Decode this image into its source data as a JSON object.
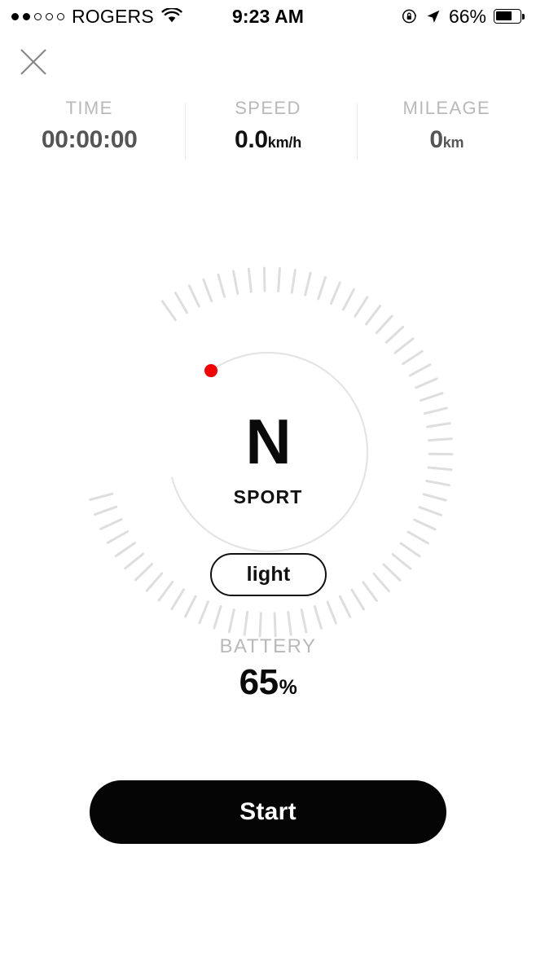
{
  "status_bar": {
    "carrier": "ROGERS",
    "signal_dots_filled": 2,
    "signal_dots_total": 5,
    "wifi_icon": "wifi-icon",
    "time": "9:23 AM",
    "rotation_lock_icon": "rotation-lock-icon",
    "location_icon": "location-arrow-icon",
    "battery_percent": "66%",
    "battery_icon": "battery-icon"
  },
  "nav": {
    "close_icon": "close-icon"
  },
  "stats": [
    {
      "label": "TIME",
      "value": "00:00:00",
      "unit": "",
      "emphasis": false
    },
    {
      "label": "SPEED",
      "value": "0.0",
      "unit": "km/h",
      "emphasis": true
    },
    {
      "label": "MILEAGE",
      "value": "0",
      "unit": "km",
      "emphasis": false
    }
  ],
  "gauge": {
    "gear": "N",
    "mode": "SPORT",
    "marker_color": "#f40000",
    "tick_color": "#dedede",
    "arc_color": "#e4e4e4",
    "tick_count": 61,
    "arc_start_deg": 125,
    "arc_sweep_deg": 290
  },
  "light_button": {
    "label": "light"
  },
  "battery": {
    "label": "BATTERY",
    "value": "65",
    "unit": "%"
  },
  "primary_action": {
    "label": "Start"
  },
  "colors": {
    "accent_red": "#f40000",
    "muted_gray": "#b9b9b9",
    "text_dark": "#111111",
    "button_black": "#050505"
  }
}
